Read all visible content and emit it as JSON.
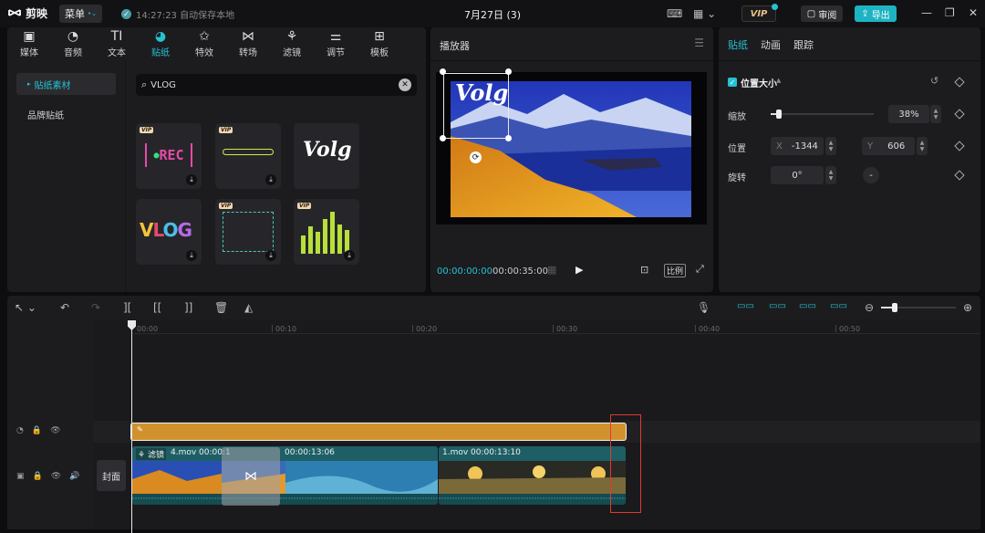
{
  "app": {
    "name": "剪映",
    "menu_label": "菜单",
    "save_status": "14:27:23 自动保存本地",
    "project_title": "7月27日 (3)",
    "vip": "VIP",
    "review": "审阅",
    "export": "导出"
  },
  "media_tabs": [
    {
      "icon": "film-icon",
      "label": "媒体"
    },
    {
      "icon": "music-icon",
      "label": "音频"
    },
    {
      "icon": "text-icon",
      "label": "文本"
    },
    {
      "icon": "sticker-icon",
      "label": "贴纸"
    },
    {
      "icon": "effects-icon",
      "label": "特效"
    },
    {
      "icon": "transition-icon",
      "label": "转场"
    },
    {
      "icon": "filter-icon",
      "label": "滤镜"
    },
    {
      "icon": "adjust-icon",
      "label": "调节"
    },
    {
      "icon": "template-icon",
      "label": "模板"
    }
  ],
  "active_tab_index": 3,
  "sidebar": {
    "items": [
      {
        "label": "贴纸素材"
      },
      {
        "label": "品牌贴纸"
      }
    ]
  },
  "search": {
    "value": "VLOG"
  },
  "stickers": [
    {
      "vip": true,
      "title": "[•REC]",
      "download": true
    },
    {
      "vip": true,
      "title": "",
      "download": true
    },
    {
      "vip": false,
      "title": "Volg",
      "download": false
    },
    {
      "vip": false,
      "title": "VLOG",
      "download": true
    },
    {
      "vip": true,
      "title": "",
      "download": true
    },
    {
      "vip": true,
      "title": "",
      "download": true
    }
  ],
  "player": {
    "title": "播放器",
    "overlay_text": "Volg",
    "current_time": "00:00:00:00",
    "total_time": "00:00:35:00",
    "ratio_label": "比例"
  },
  "properties": {
    "tabs": [
      {
        "label": "贴纸"
      },
      {
        "label": "动画"
      },
      {
        "label": "跟踪"
      }
    ],
    "section": "位置大小",
    "scale": {
      "label": "缩放",
      "value": "38%",
      "level": 0.38
    },
    "position": {
      "label": "位置",
      "x_label": "X",
      "x_value": "-1344",
      "y_label": "Y",
      "y_value": "606"
    },
    "rotation": {
      "label": "旋转",
      "value": "0°"
    }
  },
  "timeline": {
    "ticks": [
      "00:00",
      "00:10",
      "00:20",
      "00:30",
      "00:40",
      "00:50"
    ],
    "cover_label": "封面",
    "clip_a": {
      "badge": "滤镜",
      "name": "4.mov",
      "duration": "00:00:13:06"
    },
    "clip_b": {
      "name": "1.mov",
      "duration": "00:00:13:10"
    }
  },
  "colors": {
    "accent": "#25c2d2",
    "sticker_track": "#d1922e",
    "video_track": "#1e5f66",
    "highlight": "#e03a30"
  }
}
